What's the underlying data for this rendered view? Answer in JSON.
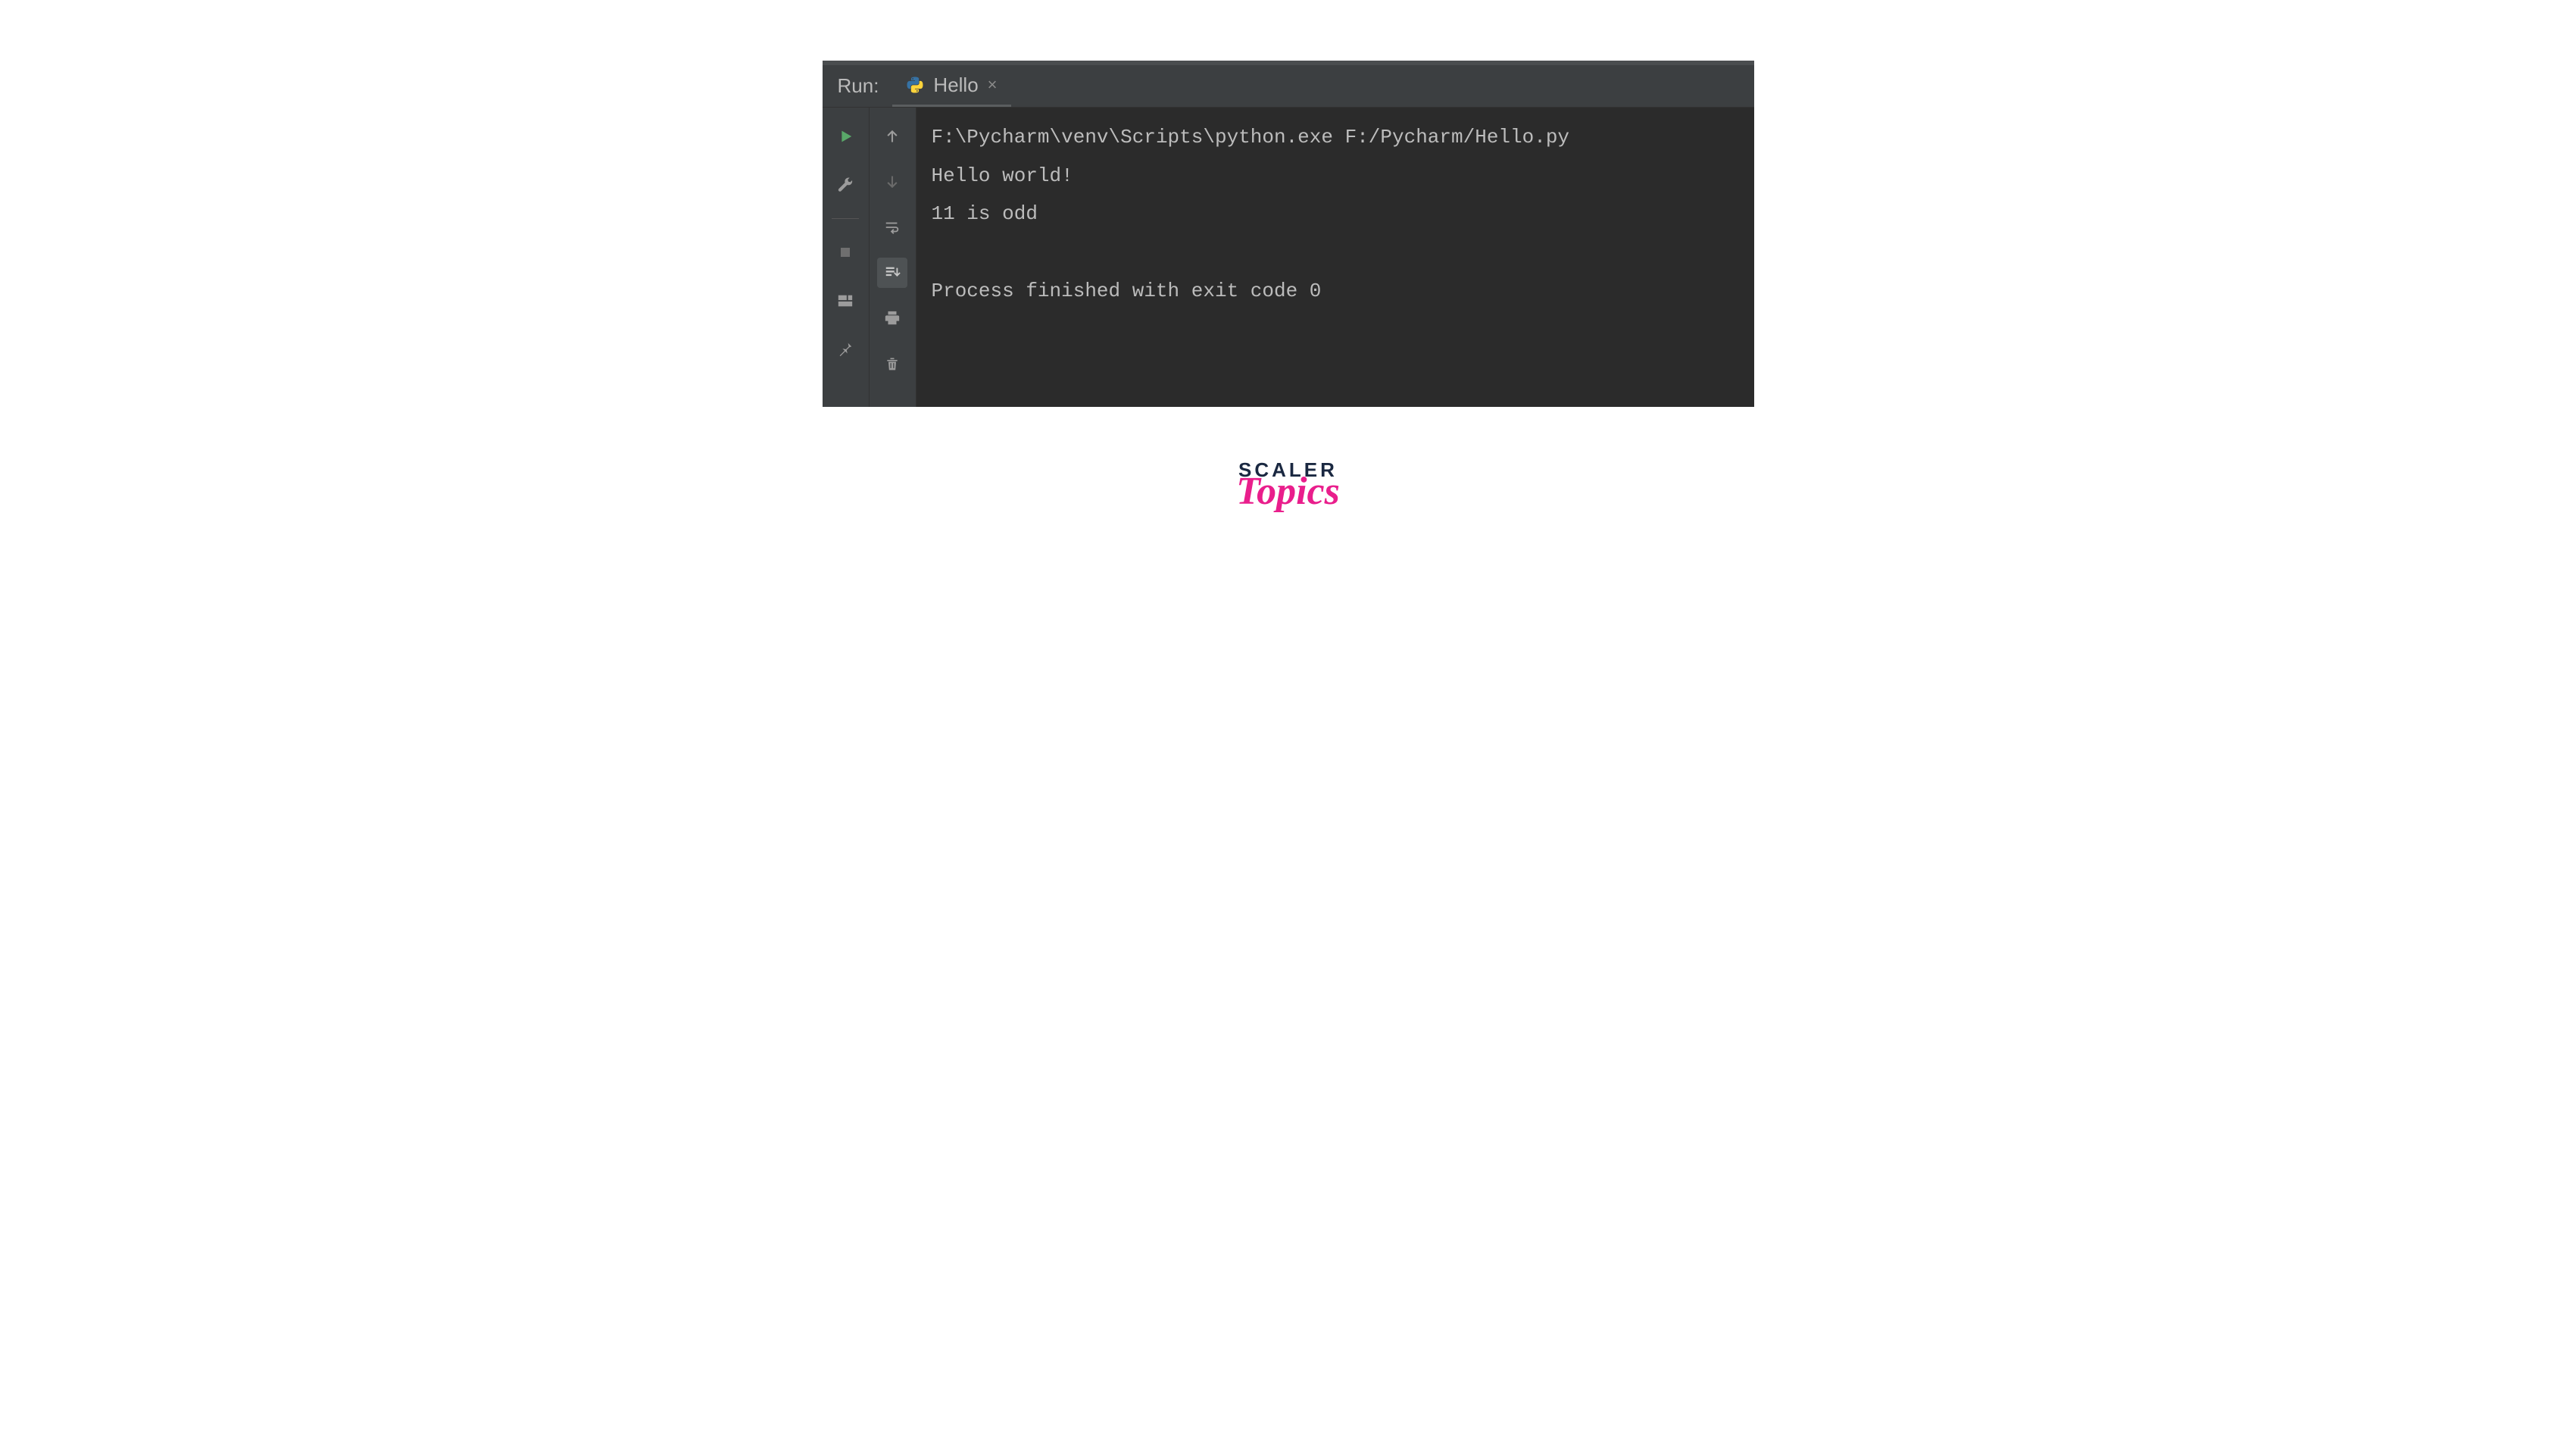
{
  "header": {
    "run_label": "Run:",
    "tab": {
      "title": "Hello",
      "close_glyph": "×"
    }
  },
  "console": {
    "lines": [
      "F:\\Pycharm\\venv\\Scripts\\python.exe F:/Pycharm/Hello.py",
      "Hello world!",
      "11 is odd",
      "",
      "Process finished with exit code 0"
    ]
  },
  "gutter_left": {
    "items": [
      {
        "name": "rerun-button",
        "icon": "play",
        "color": "#59a869"
      },
      {
        "name": "wrench-button",
        "icon": "wrench",
        "color": "#9c9c9c"
      },
      {
        "divider": true
      },
      {
        "name": "stop-button",
        "icon": "stop",
        "color": "#6f6f6f"
      },
      {
        "name": "layout-button",
        "icon": "layout",
        "color": "#9c9c9c"
      },
      {
        "name": "pin-button",
        "icon": "pin",
        "color": "#9c9c9c"
      }
    ]
  },
  "gutter_right": {
    "items": [
      {
        "name": "up-arrow-button",
        "icon": "arrow-up",
        "color": "#9c9c9c"
      },
      {
        "name": "down-arrow-button",
        "icon": "arrow-down",
        "color": "#6a6a6a"
      },
      {
        "name": "soft-wrap-button",
        "icon": "wrap",
        "color": "#9c9c9c"
      },
      {
        "name": "scroll-to-end-button",
        "icon": "scroll-end",
        "color": "#9c9c9c",
        "active": true
      },
      {
        "name": "print-button",
        "icon": "print",
        "color": "#9c9c9c"
      },
      {
        "name": "clear-button",
        "icon": "trash",
        "color": "#9c9c9c"
      }
    ]
  },
  "branding": {
    "line1": "SCALER",
    "line2": "Topics"
  }
}
